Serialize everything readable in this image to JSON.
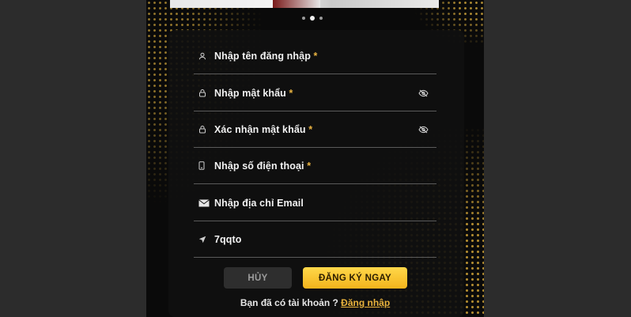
{
  "carousel": {
    "dots": 3,
    "active_index": 1
  },
  "form": {
    "fields": [
      {
        "name": "username",
        "icon": "user-icon",
        "text": "Nhập tên đăng nhập",
        "required_mark": "*"
      },
      {
        "name": "password",
        "icon": "lock-icon",
        "text": "Nhập mật khẩu",
        "required_mark": "*",
        "toggle": "eye-off-icon"
      },
      {
        "name": "confirm_password",
        "icon": "lock-icon",
        "text": "Xác nhận mật khẩu",
        "required_mark": "*",
        "toggle": "eye-off-icon"
      },
      {
        "name": "phone",
        "icon": "phone-icon",
        "text": "Nhập số điện thoại",
        "required_mark": "*"
      },
      {
        "name": "email",
        "icon": "mail-icon",
        "text": "Nhập địa chỉ Email",
        "required_mark": ""
      },
      {
        "name": "referral",
        "icon": "send-icon",
        "text": "7qqto",
        "required_mark": ""
      }
    ]
  },
  "buttons": {
    "cancel_label": "HỦY",
    "register_label": "ĐĂNG KÝ NGAY"
  },
  "footer": {
    "prompt": "Bạn đã có tài khoản ? ",
    "login_link": "Đăng nhập"
  },
  "colors": {
    "accent": "#e9b341",
    "button_gold": "#f7c52e",
    "panel_bg": "#0a0a0a",
    "side_bg": "#2c2c2c"
  }
}
